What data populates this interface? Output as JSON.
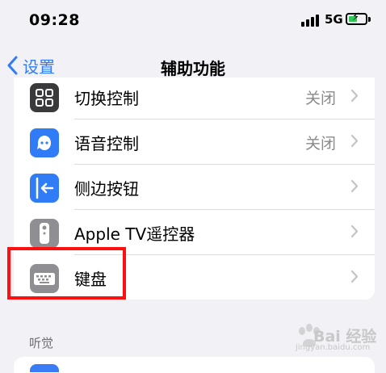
{
  "status_bar": {
    "time": "09:28",
    "network": "5G",
    "battery_level": 0.55
  },
  "nav": {
    "back_label": "设置",
    "title": "辅助功能"
  },
  "rows": [
    {
      "label": "切换控制",
      "value": "关闭",
      "icon": "switch-control-icon",
      "icon_color": "#3a3a3c"
    },
    {
      "label": "语音控制",
      "value": "关闭",
      "icon": "voice-control-icon",
      "icon_color": "#2f7cf6"
    },
    {
      "label": "侧边按钮",
      "value": "",
      "icon": "side-button-icon",
      "icon_color": "#2f7cf6"
    },
    {
      "label": "Apple TV遥控器",
      "value": "",
      "icon": "tv-remote-icon",
      "icon_color": "#8e8e93"
    },
    {
      "label": "键盘",
      "value": "",
      "icon": "keyboard-icon",
      "icon_color": "#8e8e93"
    }
  ],
  "section_header": "听觉",
  "colors": {
    "accent": "#2f7cf6",
    "highlight": "#ff1010",
    "background": "#f1f1f6",
    "battery_fill": "#35c759"
  },
  "watermark": {
    "text": "Bai 经验",
    "url": "jingyan.baidu.com"
  }
}
